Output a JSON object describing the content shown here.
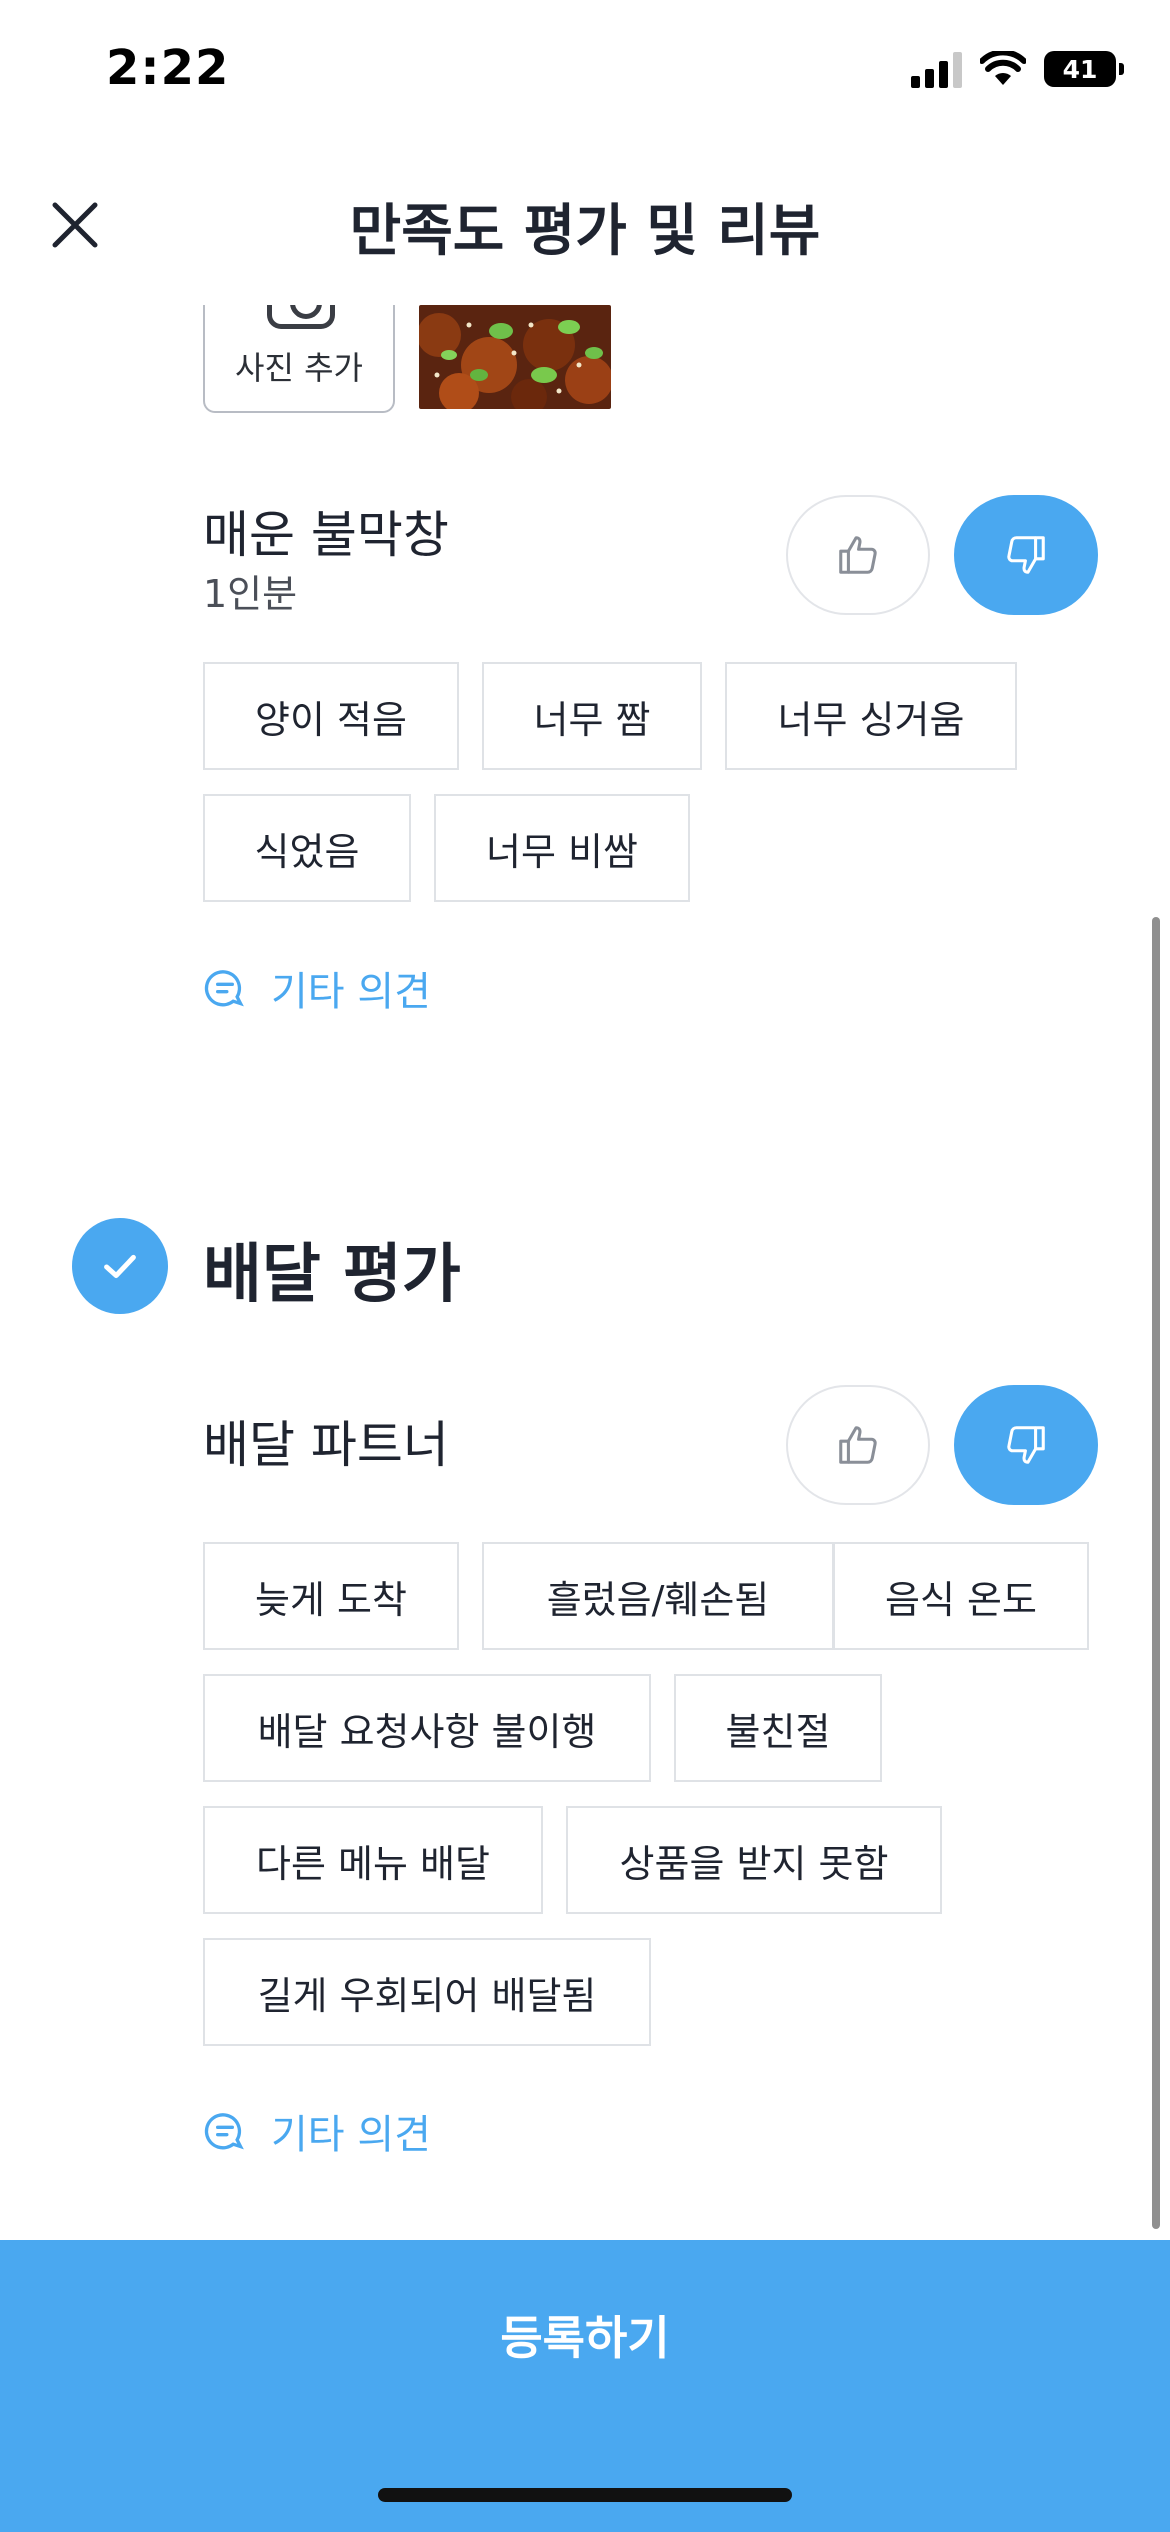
{
  "status_bar": {
    "time": "2:22",
    "battery": "41"
  },
  "header": {
    "title": "만족도 평가 및 리뷰"
  },
  "photo_section": {
    "add_photo_label": "사진 추가"
  },
  "menu_item": {
    "name": "매운 불막창",
    "quantity": "1인분",
    "selected_vote": "dislike",
    "chips": [
      "양이 적음",
      "너무 짬",
      "너무 싱거움",
      "식었음",
      "너무 비쌈"
    ],
    "other_opinion": "기타 의견"
  },
  "delivery_section": {
    "title": "배달 평가",
    "partner_label": "배달 파트너",
    "selected_vote": "dislike",
    "chips": [
      "늦게 도착",
      "흘렀음/훼손됨",
      "음식 온도",
      "배달 요청사항 불이행",
      "불친절",
      "다른 메뉴 배달",
      "상품을 받지 못함",
      "길게 우회되어 배달됨"
    ],
    "other_opinion": "기타 의견"
  },
  "submit": {
    "label": "등록하기"
  },
  "colors": {
    "accent": "#4aa8f0",
    "text": "#1f2430",
    "chip_border": "#dfe2e6"
  }
}
